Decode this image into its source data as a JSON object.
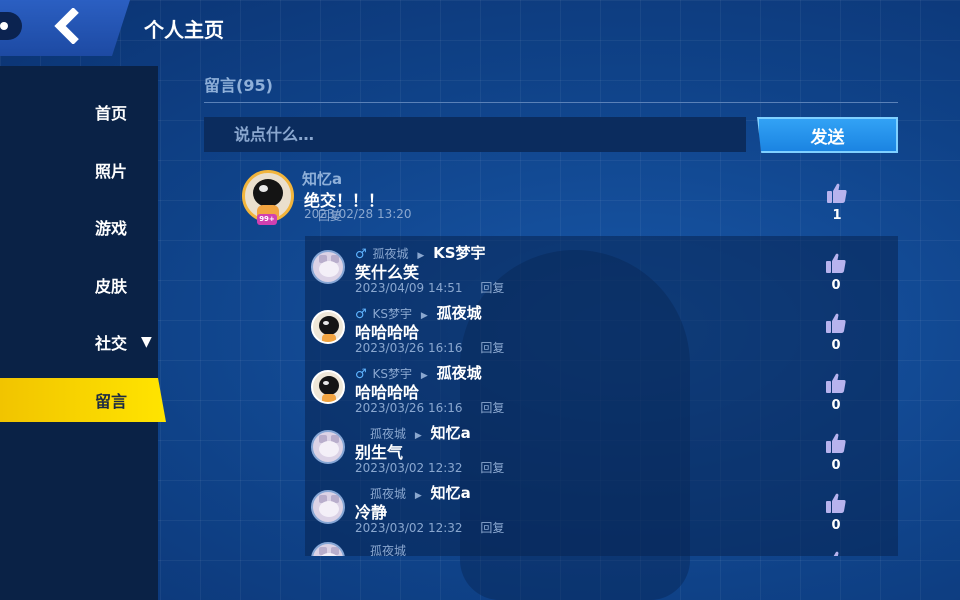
{
  "header": {
    "title": "个人主页",
    "back_icon": "chevron-left-icon"
  },
  "sidebar": {
    "items": [
      {
        "label": "首页",
        "active": false
      },
      {
        "label": "照片",
        "active": false
      },
      {
        "label": "游戏",
        "active": false
      },
      {
        "label": "皮肤",
        "active": false
      },
      {
        "label": "社交",
        "active": false,
        "caret": "▼"
      },
      {
        "label": "留言",
        "active": true
      }
    ],
    "active_color": "#ffe400"
  },
  "guestbook": {
    "title": "留言(95)",
    "input_placeholder": "说点什么…",
    "send_label": "发送",
    "reply_label": "回复",
    "comment": {
      "author": "知忆a",
      "text": "绝交！！！",
      "time": "2023/02/28 13:20",
      "likes": "1",
      "badge": "99+"
    },
    "replies": [
      {
        "gender": "♂",
        "from": "孤夜城",
        "to": "KS梦宇",
        "text": "笑什么笑",
        "time": "2023/04/09 14:51",
        "likes": "0",
        "avatar": "cat"
      },
      {
        "gender": "♂",
        "from": "KS梦宇",
        "to": "孤夜城",
        "text": "哈哈哈哈",
        "time": "2023/03/26 16:16",
        "likes": "0",
        "avatar": "dark"
      },
      {
        "gender": "♂",
        "from": "KS梦宇",
        "to": "孤夜城",
        "text": "哈哈哈哈",
        "time": "2023/03/26 16:16",
        "likes": "0",
        "avatar": "dark"
      },
      {
        "gender": "",
        "from": "孤夜城",
        "to": "知忆a",
        "text": "别生气",
        "time": "2023/03/02 12:32",
        "likes": "0",
        "avatar": "cat"
      },
      {
        "gender": "",
        "from": "孤夜城",
        "to": "知忆a",
        "text": "冷静",
        "time": "2023/03/02 12:32",
        "likes": "0",
        "avatar": "cat"
      },
      {
        "gender": "",
        "from": "孤夜城",
        "to": "",
        "text": "",
        "time": "",
        "likes": "",
        "avatar": "cat"
      }
    ]
  },
  "colors": {
    "background": "#0f4288",
    "sidebar": "#0a2246",
    "send_button": "#1b84e2",
    "like_icon": "#b7b3ee"
  }
}
